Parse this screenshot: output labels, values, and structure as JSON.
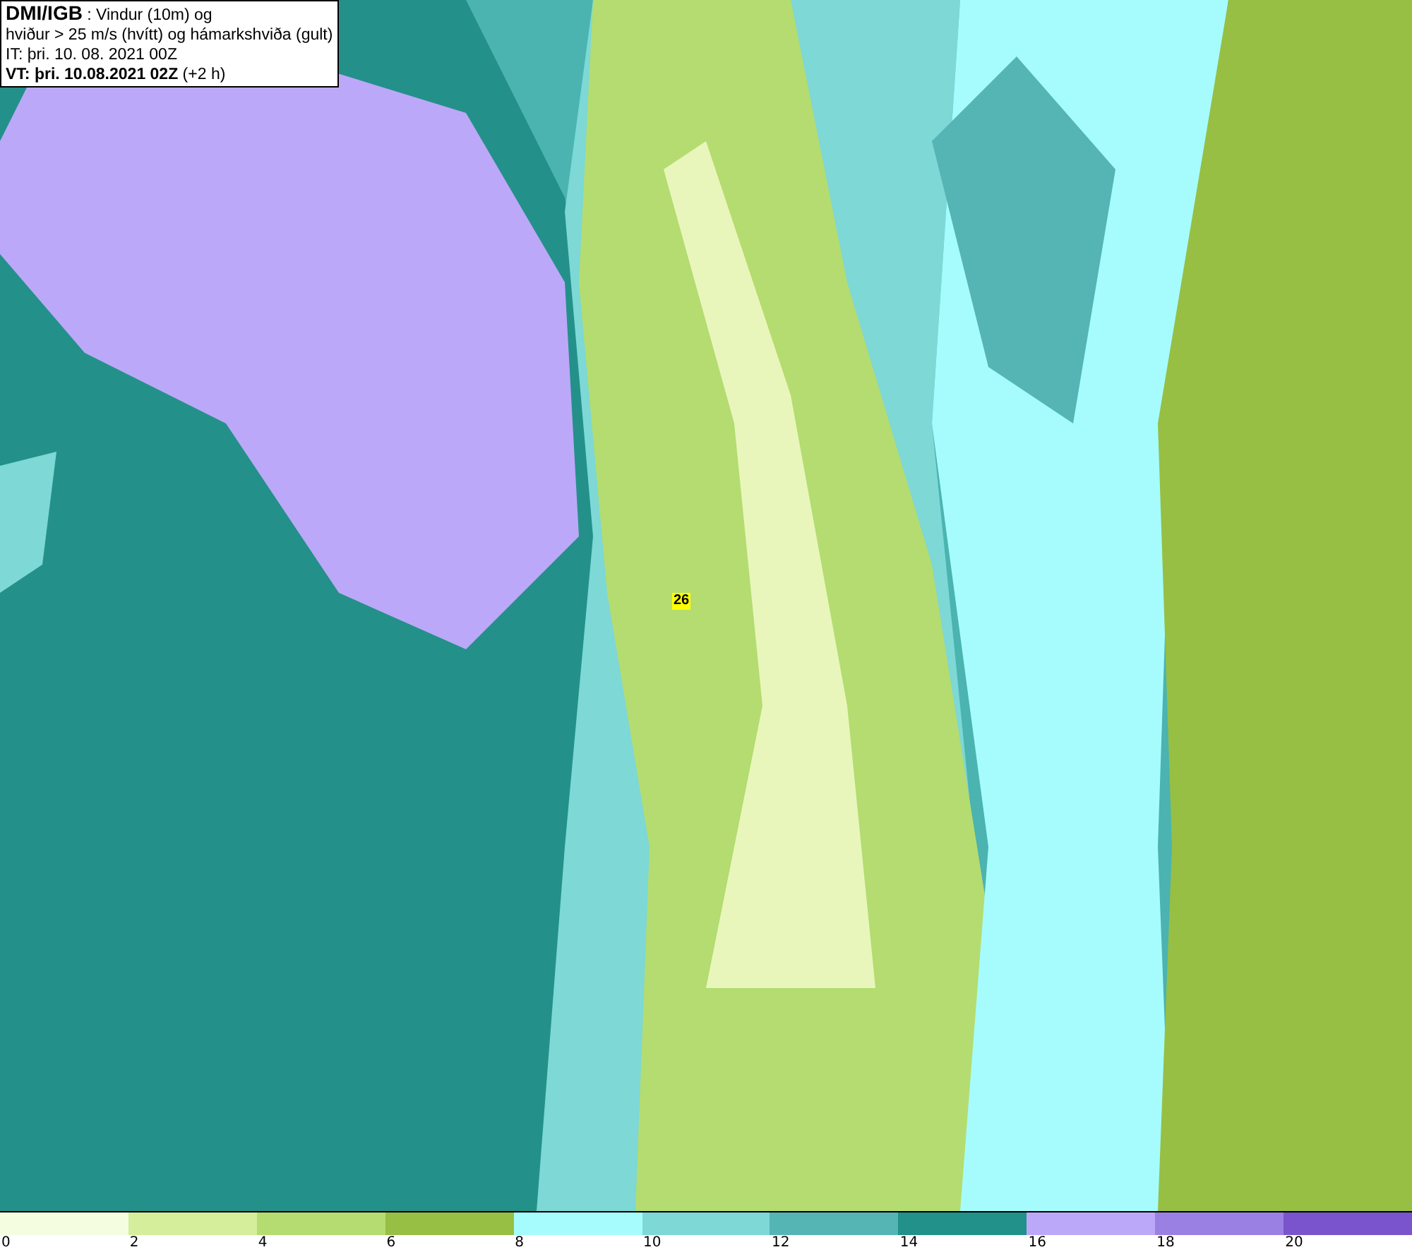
{
  "header": {
    "lines": [
      "**DMI/IGB** : Vindur (10m) og",
      "hviður > 25 m/s (hvítt) og hámarkshviða (gult)",
      "IT: þri. 10. 08. 2021 00Z",
      "**VT: þri. 10.08.2021 02Z** (+2 h)"
    ]
  },
  "map": {
    "labels": [
      {
        "text": "26"
      }
    ]
  },
  "legend": [
    {
      "label": "0",
      "color": "#f5fde0"
    },
    {
      "label": "2",
      "color": "#d4ee9c"
    },
    {
      "label": "4",
      "color": "#b4dc70"
    },
    {
      "label": "6",
      "color": "#96bf44"
    },
    {
      "label": "8",
      "color": "#a6fcfc"
    },
    {
      "label": "10",
      "color": "#7dd8d6"
    },
    {
      "label": "12",
      "color": "#55b4b4"
    },
    {
      "label": "14",
      "color": "#219189"
    },
    {
      "label": "16",
      "color": "#bca8f8"
    },
    {
      "label": "18",
      "color": "#9a80e2"
    },
    {
      "label": "20",
      "color": "#7a54cc"
    }
  ]
}
